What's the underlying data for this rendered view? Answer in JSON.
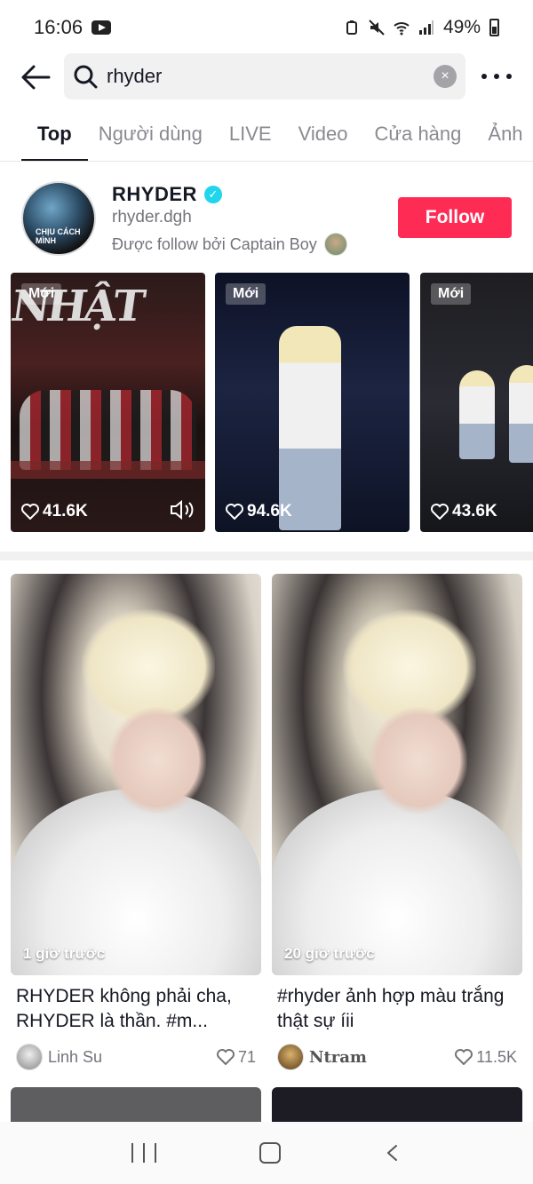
{
  "status_bar": {
    "time": "16:06",
    "battery": "49%"
  },
  "search": {
    "query": "rhyder",
    "clear": "×"
  },
  "tabs": [
    {
      "label": "Top",
      "active": true
    },
    {
      "label": "Người dùng"
    },
    {
      "label": "LIVE"
    },
    {
      "label": "Video"
    },
    {
      "label": "Cửa hàng"
    },
    {
      "label": "Ảnh"
    }
  ],
  "user": {
    "name": "RHYDER",
    "handle": "rhyder.dgh",
    "followed_by": "Được follow bởi Captain Boy",
    "follow_label": "Follow",
    "avatar_text": "CHỊU CÁCH MÌNH",
    "verified_mark": "✓"
  },
  "strip_videos": [
    {
      "badge": "Mới",
      "likes": "41.6K"
    },
    {
      "badge": "Mới",
      "likes": "94.6K"
    },
    {
      "badge": "Mới",
      "likes": "43.6K"
    }
  ],
  "grid_videos": [
    {
      "time": "1 giờ trước",
      "caption": "RHYDER không phải cha, RHYDER là thần. #m...",
      "author": "Linh Su",
      "likes": "71"
    },
    {
      "time": "20 giờ trước",
      "caption": "#rhyder ảnh hợp màu trắng thật sự íii",
      "author": "Ntram",
      "likes": "11.5K"
    }
  ],
  "colors": {
    "follow_red": "#fe2c55",
    "verified_cyan": "#20d5ec"
  }
}
